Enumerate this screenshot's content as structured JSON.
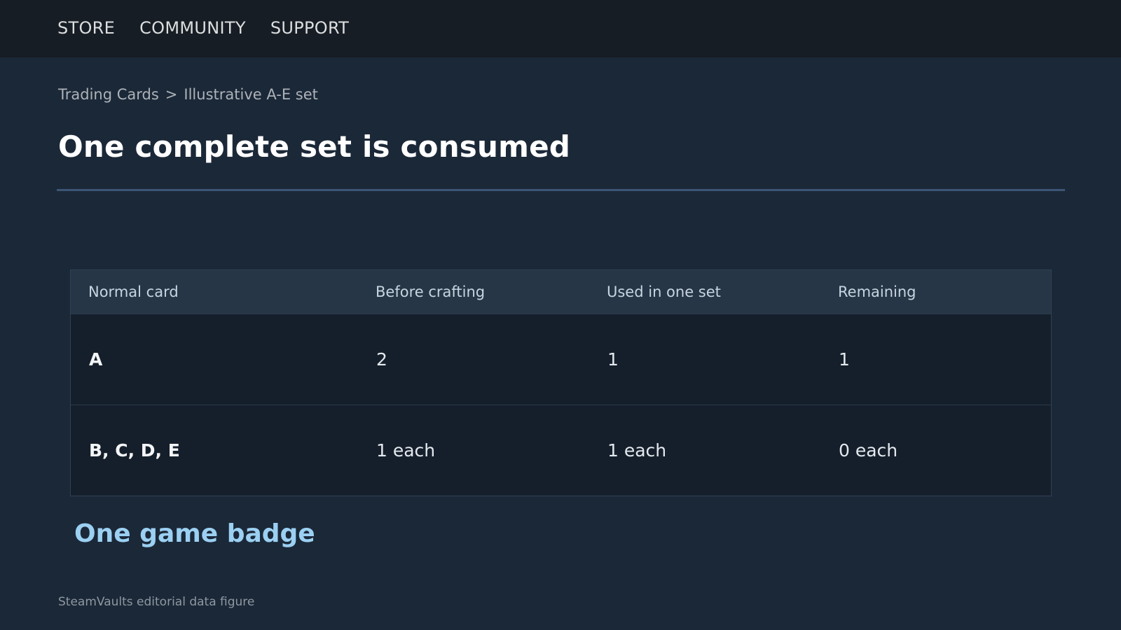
{
  "nav": {
    "items": [
      "STORE",
      "COMMUNITY",
      "SUPPORT"
    ]
  },
  "breadcrumb": {
    "parent": "Trading Cards",
    "separator": ">",
    "current": "Illustrative A-E set"
  },
  "page": {
    "title": "One complete set is consumed"
  },
  "table": {
    "headers": [
      "Normal card",
      "Before crafting",
      "Used in one set",
      "Remaining"
    ],
    "rows": [
      [
        "A",
        "2",
        "1",
        "1"
      ],
      [
        "B, C, D, E",
        "1 each",
        "1 each",
        "0 each"
      ]
    ]
  },
  "result": {
    "heading": "One game badge"
  },
  "footer": {
    "note": "SteamVaults editorial data figure"
  },
  "colors": {
    "background": "#1b2838",
    "topbar": "#171d25",
    "accent_heading": "#9bd0f2",
    "rule": "#3b5575"
  }
}
